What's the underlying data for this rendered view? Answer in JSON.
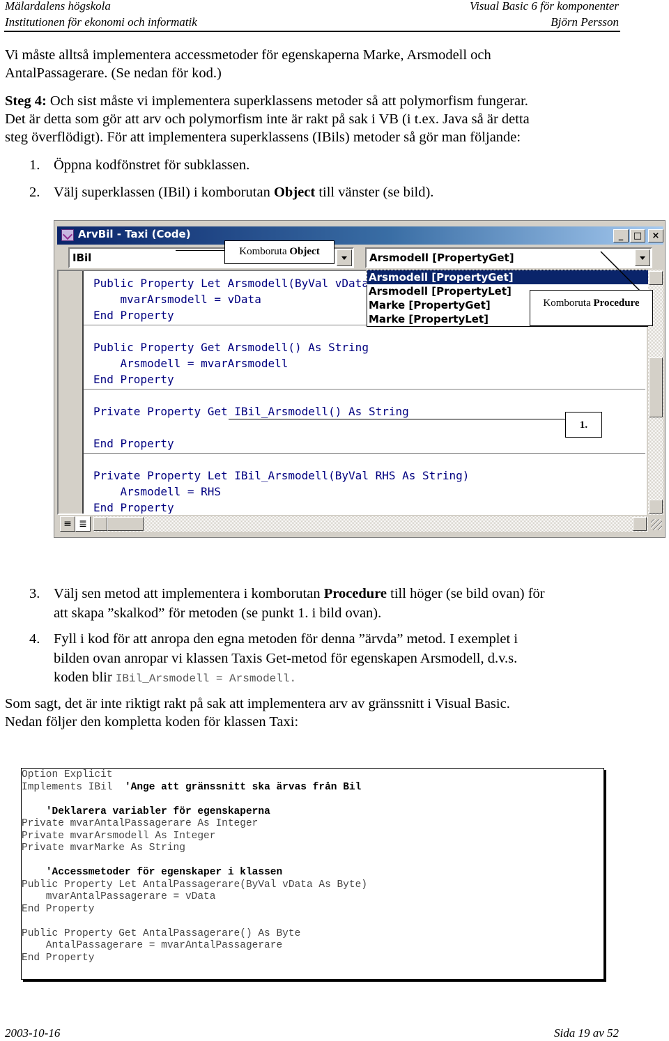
{
  "header": {
    "institution": "Mälardalens högskola",
    "department": "Institutionen för ekonomi och informatik",
    "course": "Visual Basic 6 för komponenter",
    "author": "Björn Persson"
  },
  "intro": {
    "line1": "Vi måste alltså implementera accessmetoder för egenskaperna Marke, Arsmodell och",
    "line2": "AntalPassagerare. (Se nedan för kod.)"
  },
  "step4": {
    "label": "Steg 4:",
    "line1_rest": " Och sist måste vi implementera superklassens metoder så att polymorfism fungerar.",
    "line2": "Det är detta som gör att arv och polymorfism inte är rakt på sak i VB (i t.ex. Java så är detta",
    "line3": "steg överflödigt). För att implementera superklassens (IBils) metoder så gör man följande:"
  },
  "list_top": [
    {
      "num": "1.",
      "text": "Öppna kodfönstret för subklassen."
    },
    {
      "num": "2.",
      "text_before": "Välj superklassen (IBil) i komborutan ",
      "bold": "Object",
      "text_after": " till vänster (se bild)."
    }
  ],
  "vb_window": {
    "title": "ArvBil - Taxi (Code)",
    "buttons": {
      "minimize": "_",
      "maximize": "□",
      "close": "×"
    },
    "object_combo": {
      "value": "IBil"
    },
    "procedure_combo": {
      "value": "Arsmodell [PropertyGet]"
    },
    "procedure_dropdown": {
      "items": [
        "Arsmodell [PropertyGet]",
        "Arsmodell [PropertyLet]",
        "Marke [PropertyGet]",
        "Marke [PropertyLet]"
      ],
      "selected_index": 0
    },
    "code_blocks": [
      [
        "Public Property Let Arsmodell(ByVal vData As String)",
        "    mvarArsmodell = vData",
        "End Property"
      ],
      [
        "Public Property Get Arsmodell() As String",
        "    Arsmodell = mvarArsmodell",
        "End Property"
      ],
      [
        "Private Property Get IBil_Arsmodell() As String",
        "",
        "End Property"
      ],
      [
        "Private Property Let IBil_Arsmodell(ByVal RHS As String)",
        "    Arsmodell = RHS",
        "End Property"
      ]
    ],
    "callouts": {
      "object_prefix": "Komboruta ",
      "object_bold": "Object",
      "procedure_prefix": "Komboruta ",
      "procedure_bold": "Procedure",
      "step1": "1."
    }
  },
  "list_bottom": [
    {
      "num": "3.",
      "line1_before": "Välj sen metod att implementera i komborutan ",
      "line1_bold": "Procedure",
      "line1_after": " till höger (se bild ovan) för",
      "line2": "att skapa ”skalkod” för metoden (se punkt 1. i bild ovan)."
    },
    {
      "num": "4.",
      "line1": "Fyll i kod för att anropa den egna metoden för denna ”ärvda” metod. I exemplet i",
      "line2": "bilden ovan anropar vi klassen Taxis Get-metod för egenskapen Arsmodell, d.v.s.",
      "line3_before": "koden blir ",
      "line3_code": "IBil_Arsmodell = Arsmodell."
    }
  ],
  "outro": {
    "line1": "Som sagt, det är inte riktigt rakt på sak att implementera arv av gränssnitt i Visual Basic.",
    "line2": "Nedan följer den kompletta koden för klassen Taxi:"
  },
  "listing": [
    {
      "code": "Option Explicit",
      "comment": ""
    },
    {
      "code": "Implements IBil  ",
      "comment": "'Ange att gränssnitt ska ärvas från Bil"
    },
    {
      "code": "",
      "comment": ""
    },
    {
      "code": "    ",
      "comment": "'Deklarera variabler för egenskaperna"
    },
    {
      "code": "Private mvarAntalPassagerare As Integer",
      "comment": ""
    },
    {
      "code": "Private mvarArsmodell As Integer",
      "comment": ""
    },
    {
      "code": "Private mvarMarke As String",
      "comment": ""
    },
    {
      "code": "",
      "comment": ""
    },
    {
      "code": "    ",
      "comment": "'Accessmetoder för egenskaper i klassen"
    },
    {
      "code": "Public Property Let AntalPassagerare(ByVal vData As Byte)",
      "comment": ""
    },
    {
      "code": "    mvarAntalPassagerare = vData",
      "comment": ""
    },
    {
      "code": "End Property",
      "comment": ""
    },
    {
      "code": "",
      "comment": ""
    },
    {
      "code": "Public Property Get AntalPassagerare() As Byte",
      "comment": ""
    },
    {
      "code": "    AntalPassagerare = mvarAntalPassagerare",
      "comment": ""
    },
    {
      "code": "End Property",
      "comment": ""
    }
  ],
  "footer": {
    "date": "2003-10-16",
    "page": "Sida 19 av 52"
  }
}
